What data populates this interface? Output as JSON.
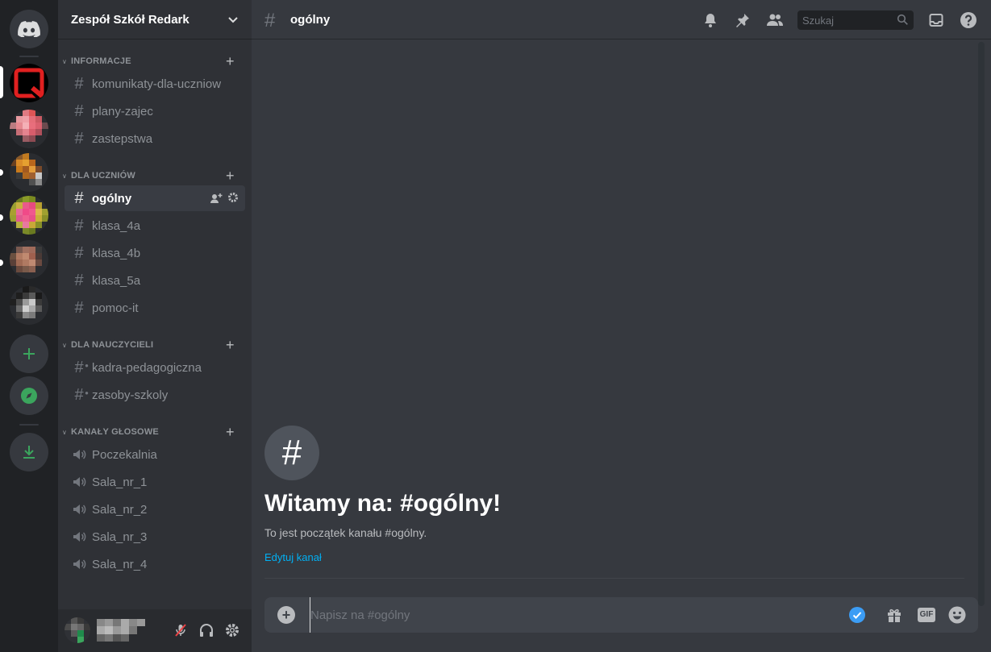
{
  "rail": {
    "home_icon": "discord-logo-icon",
    "add_server_icon": "plus-icon",
    "explore_icon": "compass-icon",
    "download_icon": "download-icon",
    "accent_green": "#3ba55d"
  },
  "guild": {
    "name": "Zespół Szkół Redark"
  },
  "categories": [
    {
      "label": "INFORMACJE",
      "channels": [
        {
          "name": "komunikaty-dla-uczniow",
          "type": "text"
        },
        {
          "name": "plany-zajec",
          "type": "text"
        },
        {
          "name": "zastepstwa",
          "type": "text"
        }
      ]
    },
    {
      "label": "DLA UCZNIÓW",
      "channels": [
        {
          "name": "ogólny",
          "type": "text",
          "active": true
        },
        {
          "name": "klasa_4a",
          "type": "text"
        },
        {
          "name": "klasa_4b",
          "type": "text"
        },
        {
          "name": "klasa_5a",
          "type": "text"
        },
        {
          "name": "pomoc-it",
          "type": "text"
        }
      ]
    },
    {
      "label": "DLA NAUCZYCIELI",
      "channels": [
        {
          "name": "kadra-pedagogiczna",
          "type": "text-locked"
        },
        {
          "name": "zasoby-szkoly",
          "type": "text-locked"
        }
      ]
    },
    {
      "label": "KANAŁY GŁOSOWE",
      "channels": [
        {
          "name": "Poczekalnia",
          "type": "voice"
        },
        {
          "name": "Sala_nr_1",
          "type": "voice"
        },
        {
          "name": "Sala_nr_2",
          "type": "voice"
        },
        {
          "name": "Sala_nr_3",
          "type": "voice"
        },
        {
          "name": "Sala_nr_4",
          "type": "voice"
        }
      ]
    }
  ],
  "header": {
    "channel_name": "ogólny",
    "search_placeholder": "Szukaj"
  },
  "welcome": {
    "icon_glyph": "#",
    "title": "Witamy na: #ogólny!",
    "subtitle": "To jest początek kanału #ogólny.",
    "edit_link": "Edytuj kanał"
  },
  "composer": {
    "placeholder": "Napisz na #ogólny",
    "gif_label": "GIF"
  }
}
